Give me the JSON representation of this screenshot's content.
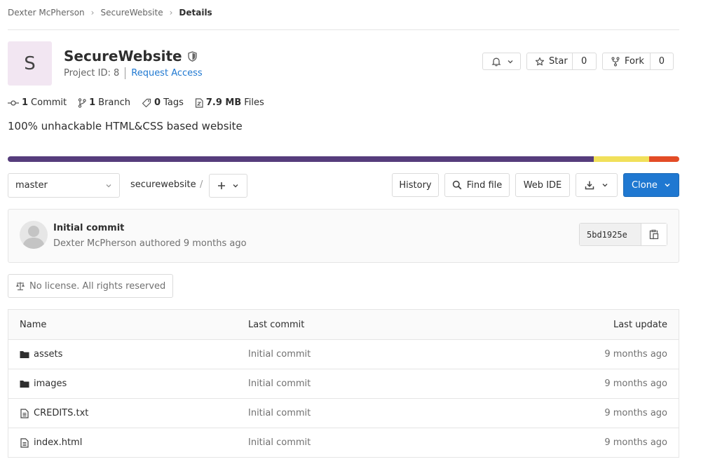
{
  "breadcrumb": {
    "owner": "Dexter McPherson",
    "project": "SecureWebsite",
    "current": "Details"
  },
  "project": {
    "avatar_letter": "S",
    "name": "SecureWebsite",
    "id_label": "Project ID: 8",
    "request_access": "Request Access",
    "description": "100% unhackable HTML&CSS based website"
  },
  "actions": {
    "star_label": "Star",
    "star_count": "0",
    "fork_label": "Fork",
    "fork_count": "0"
  },
  "stats": {
    "commits_count": "1",
    "commits_label": "Commit",
    "branches_count": "1",
    "branches_label": "Branch",
    "tags_count": "0",
    "tags_label": "Tags",
    "files_size": "7.9 MB",
    "files_label": "Files"
  },
  "languages": [
    {
      "percent": 87.3,
      "color": "#563d7c"
    },
    {
      "percent": 8.2,
      "color": "#f1e05a"
    },
    {
      "percent": 4.5,
      "color": "#e34c26"
    }
  ],
  "toolbar": {
    "branch": "master",
    "path": "securewebsite",
    "path_sep": "/",
    "history": "History",
    "find_file": "Find file",
    "web_ide": "Web IDE",
    "clone": "Clone"
  },
  "last_commit": {
    "title": "Initial commit",
    "author_line": "Dexter McPherson authored 9 months ago",
    "sha": "5bd1925e"
  },
  "license": "No license. All rights reserved",
  "table": {
    "headers": {
      "name": "Name",
      "last_commit": "Last commit",
      "last_update": "Last update"
    },
    "rows": [
      {
        "type": "folder",
        "name": "assets",
        "commit": "Initial commit",
        "updated": "9 months ago"
      },
      {
        "type": "folder",
        "name": "images",
        "commit": "Initial commit",
        "updated": "9 months ago"
      },
      {
        "type": "file",
        "name": "CREDITS.txt",
        "commit": "Initial commit",
        "updated": "9 months ago"
      },
      {
        "type": "file",
        "name": "index.html",
        "commit": "Initial commit",
        "updated": "9 months ago"
      }
    ]
  }
}
